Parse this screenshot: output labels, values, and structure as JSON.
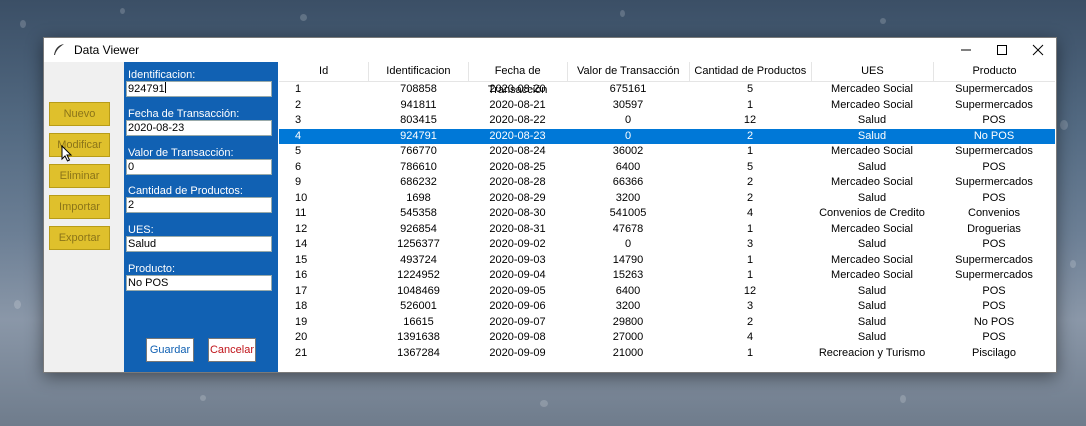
{
  "window": {
    "title": "Data Viewer"
  },
  "sidebar": {
    "buttons": [
      {
        "label": "Nuevo"
      },
      {
        "label": "Modificar"
      },
      {
        "label": "Eliminar"
      },
      {
        "label": "Importar"
      },
      {
        "label": "Exportar"
      }
    ]
  },
  "form": {
    "identificacion": {
      "label": "Identificacion:",
      "value": "924791"
    },
    "fecha": {
      "label": "Fecha de Transacción:",
      "value": "2020-08-23"
    },
    "valor": {
      "label": "Valor de Transacción:",
      "value": "0"
    },
    "cantidad": {
      "label": "Cantidad de Productos:",
      "value": "2"
    },
    "ues": {
      "label": "UES:",
      "value": "Salud"
    },
    "producto": {
      "label": "Producto:",
      "value": "No POS"
    },
    "save_label": "Guardar",
    "cancel_label": "Cancelar"
  },
  "table": {
    "columns": [
      "Id",
      "Identificacion",
      "Fecha de Transacción",
      "Valor de Transacción",
      "Cantidad de Productos",
      "UES",
      "Producto"
    ],
    "selected_index": 3,
    "rows": [
      [
        "1",
        "708858",
        "2020-08-20",
        "675161",
        "5",
        "Mercadeo Social",
        "Supermercados"
      ],
      [
        "2",
        "941811",
        "2020-08-21",
        "30597",
        "1",
        "Mercadeo Social",
        "Supermercados"
      ],
      [
        "3",
        "803415",
        "2020-08-22",
        "0",
        "12",
        "Salud",
        "POS"
      ],
      [
        "4",
        "924791",
        "2020-08-23",
        "0",
        "2",
        "Salud",
        "No POS"
      ],
      [
        "5",
        "766770",
        "2020-08-24",
        "36002",
        "1",
        "Mercadeo Social",
        "Supermercados"
      ],
      [
        "6",
        "786610",
        "2020-08-25",
        "6400",
        "5",
        "Salud",
        "POS"
      ],
      [
        "9",
        "686232",
        "2020-08-28",
        "66366",
        "2",
        "Mercadeo Social",
        "Supermercados"
      ],
      [
        "10",
        "1698",
        "2020-08-29",
        "3200",
        "2",
        "Salud",
        "POS"
      ],
      [
        "11",
        "545358",
        "2020-08-30",
        "541005",
        "4",
        "Convenios de Credito",
        "Convenios"
      ],
      [
        "12",
        "926854",
        "2020-08-31",
        "47678",
        "1",
        "Mercadeo Social",
        "Droguerias"
      ],
      [
        "14",
        "1256377",
        "2020-09-02",
        "0",
        "3",
        "Salud",
        "POS"
      ],
      [
        "15",
        "493724",
        "2020-09-03",
        "14790",
        "1",
        "Mercadeo Social",
        "Supermercados"
      ],
      [
        "16",
        "1224952",
        "2020-09-04",
        "15263",
        "1",
        "Mercadeo Social",
        "Supermercados"
      ],
      [
        "17",
        "1048469",
        "2020-09-05",
        "6400",
        "12",
        "Salud",
        "POS"
      ],
      [
        "18",
        "526001",
        "2020-09-06",
        "3200",
        "3",
        "Salud",
        "POS"
      ],
      [
        "19",
        "16615",
        "2020-09-07",
        "29800",
        "2",
        "Salud",
        "No POS"
      ],
      [
        "20",
        "1391638",
        "2020-09-08",
        "27000",
        "4",
        "Salud",
        "POS"
      ],
      [
        "21",
        "1367284",
        "2020-09-09",
        "21000",
        "1",
        "Recreacion y Turismo",
        "Piscilago"
      ]
    ]
  },
  "colors": {
    "form_panel": "#1161b3",
    "side_button": "#dfc02c",
    "selection": "#0078d7"
  }
}
